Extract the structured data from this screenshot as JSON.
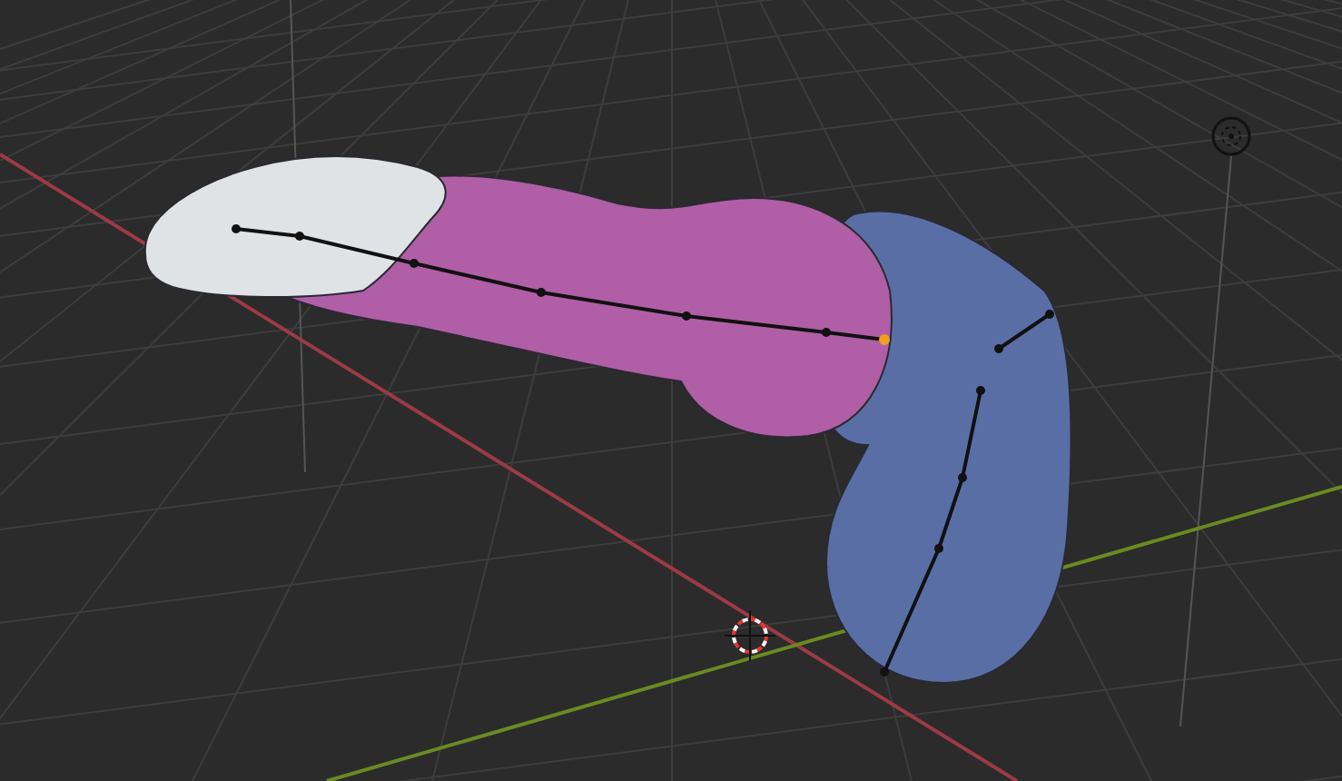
{
  "viewport": {
    "axes": [
      {
        "kind": "x",
        "color": "#9c3b45"
      },
      {
        "kind": "y",
        "color": "#6a8a22"
      }
    ],
    "mesh": {
      "segments": [
        {
          "kind": "base",
          "color": "#5a6ea6"
        },
        {
          "kind": "shaft",
          "color": "#b05ea6"
        },
        {
          "kind": "tip",
          "color": "#dfe3e6"
        }
      ]
    },
    "armature": {
      "visible": true
    }
  }
}
